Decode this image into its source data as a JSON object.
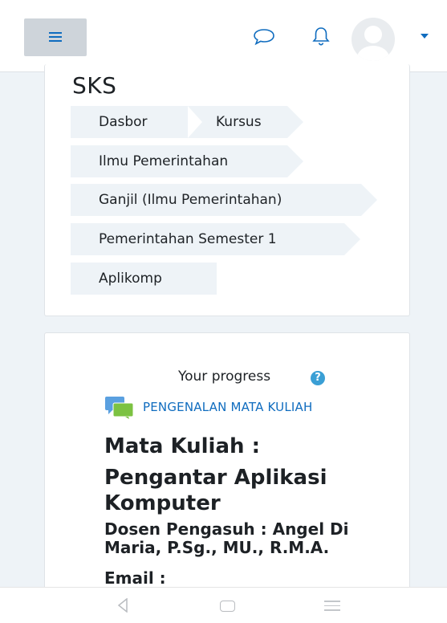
{
  "navbar": {
    "menu_icon": "hamburger-icon",
    "icons": [
      "chat-icon",
      "bell-icon",
      "avatar",
      "caret-down-icon"
    ],
    "accent_color": "#0f6cbf"
  },
  "page": {
    "title": "SKS"
  },
  "breadcrumb": {
    "items": [
      {
        "label": "Dasbor"
      },
      {
        "label": "Kursus"
      },
      {
        "label": "Ilmu Pemerintahan"
      },
      {
        "label": "Ganjil (Ilmu Pemerintahan)"
      },
      {
        "label": "Pemerintahan Semester 1"
      },
      {
        "label": "Aplikomp"
      }
    ]
  },
  "course": {
    "progress_label": "Your progress",
    "help_icon": "question-circle-icon",
    "forum_icon": "forum-icon",
    "section_link": "PENGENALAN MATA KULIAH",
    "heading_mk": "Mata Kuliah :",
    "heading_title": "Pengantar Aplikasi Komputer",
    "heading_dosen": "Dosen Pengasuh : Angel Di Maria, P.Sg., MU., R.M.A.",
    "heading_email": "Email :"
  },
  "android_nav": {
    "buttons": [
      "back-icon",
      "home-icon",
      "recents-icon"
    ]
  }
}
